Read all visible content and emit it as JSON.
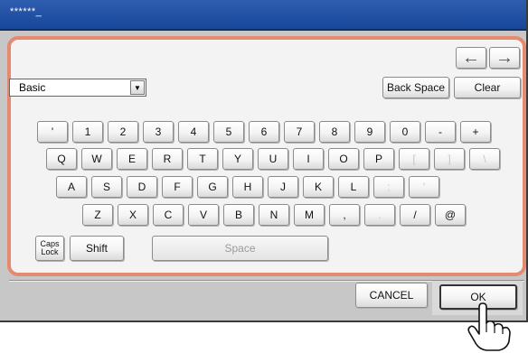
{
  "input": {
    "value": "******_"
  },
  "arrows": {
    "left": "←",
    "right": "→"
  },
  "mode_select": {
    "selected": "Basic",
    "arrow": "▼"
  },
  "actions": {
    "back_space": "Back Space",
    "clear": "Clear"
  },
  "keyboard": {
    "row1": [
      "'",
      "1",
      "2",
      "3",
      "4",
      "5",
      "6",
      "7",
      "8",
      "9",
      "0",
      "-",
      "+"
    ],
    "row2": [
      "Q",
      "W",
      "E",
      "R",
      "T",
      "Y",
      "U",
      "I",
      "O",
      "P",
      "[",
      "]",
      "\\"
    ],
    "row3": [
      "A",
      "S",
      "D",
      "F",
      "G",
      "H",
      "J",
      "K",
      "L",
      ";",
      "'"
    ],
    "row4": [
      "Z",
      "X",
      "C",
      "V",
      "B",
      "N",
      "M",
      ",",
      ".",
      "/",
      "@"
    ],
    "caps_line1": "Caps",
    "caps_line2": "Lock",
    "shift": "Shift",
    "space": "Space"
  },
  "footer": {
    "cancel": "CANCEL",
    "ok": "OK"
  },
  "icons": {
    "pointer": "hand-pointer-icon"
  },
  "colors": {
    "title_bar": "#17479a",
    "panel_border": "#e58a6f",
    "screen_bg": "#c7c7c7"
  }
}
